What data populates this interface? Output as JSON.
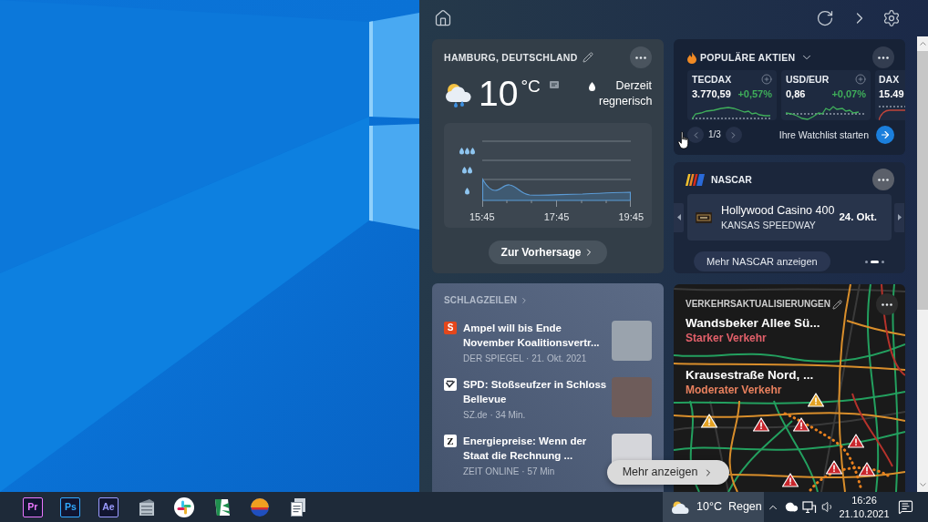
{
  "weather": {
    "location": "HAMBURG, DEUTSCHLAND",
    "temperature": "10",
    "unit": "°C",
    "condition": "Derzeit regnerisch",
    "chart": {
      "time_labels": [
        "15:45",
        "17:45",
        "19:45"
      ]
    },
    "forecast_button": "Zur Vorhersage"
  },
  "stocks": {
    "title": "POPULÄRE AKTIEN",
    "tiles": [
      {
        "symbol": "TECDAX",
        "price": "3.770,59",
        "change": "+0,57%",
        "color": "#3fae5a"
      },
      {
        "symbol": "USD/EUR",
        "price": "0,86",
        "change": "+0,07%",
        "color": "#3fae5a"
      },
      {
        "symbol": "DAX",
        "price": "15.49",
        "color": "#c0453a"
      }
    ],
    "pager": "1/3",
    "watchlist_link": "Ihre Watchlist starten"
  },
  "nascar": {
    "title": "NASCAR",
    "event": {
      "name": "Hollywood Casino 400",
      "venue": "KANSAS SPEEDWAY",
      "date": "24. Okt."
    },
    "more_button": "Mehr NASCAR anzeigen",
    "dots": [
      {
        "selected": false
      },
      {
        "selected": true
      },
      {
        "selected": false
      }
    ]
  },
  "news": {
    "title": "SCHLAGZEILEN",
    "items": [
      {
        "logo": {
          "kind": "filled",
          "text": "S",
          "color": "#e4471b"
        },
        "title": "Ampel will bis Ende November Koalitionsvertr...",
        "meta": "DER SPIEGEL · 21. Okt. 2021"
      },
      {
        "logo": {
          "kind": "emblem"
        },
        "title": "SPD: Stoßseufzer in Schloss Bellevue",
        "meta": "SZ.de · 34 Min."
      },
      {
        "logo": {
          "kind": "plain",
          "text": "Z"
        },
        "title": "Energiepreise: Wenn der Staat die Rechnung ...",
        "meta": "ZEIT ONLINE · 57 Min"
      }
    ]
  },
  "show_more_button": "Mehr anzeigen",
  "traffic": {
    "title": "VERKEHRSAKTUALISIERUNGEN",
    "routes": [
      {
        "name": "Wandsbeker Allee Sü...",
        "status": "Starker Verkehr",
        "color": "#e2606a"
      },
      {
        "name": "Krausestraße Nord, ...",
        "status": "Moderater Verkehr",
        "color": "#e8805e"
      }
    ]
  },
  "taskbar": {
    "apps": [
      {
        "kind": "letters",
        "text": "Pr",
        "color": "#ea77ff"
      },
      {
        "kind": "letters",
        "text": "Ps",
        "color": "#31a8ff"
      },
      {
        "kind": "letters",
        "text": "Ae",
        "color": "#9999ff"
      },
      {
        "kind": "cabinet"
      },
      {
        "kind": "pinwheel"
      },
      {
        "kind": "sheet"
      },
      {
        "kind": "disc"
      },
      {
        "kind": "papers"
      }
    ],
    "weather": {
      "temperature": "10°C",
      "condition": "Regen",
      "open": true
    },
    "clock": {
      "time": "16:26",
      "date": "21.10.2021"
    }
  }
}
